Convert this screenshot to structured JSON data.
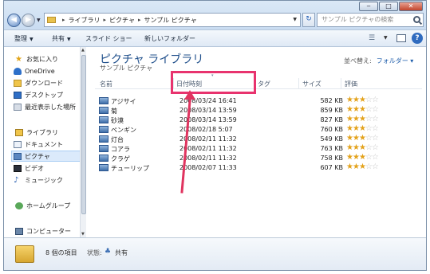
{
  "window": {
    "minimize": "‒",
    "maximize": "□",
    "close": "✕"
  },
  "address": {
    "crumbs": [
      "ライブラリ",
      "ピクチャ",
      "サンプル ピクチャ"
    ],
    "separator": "▸",
    "search_placeholder": "サンプル ピクチャの検索"
  },
  "toolbar": {
    "organize": "整理",
    "share": "共有",
    "slideshow": "スライド ショー",
    "new_folder": "新しいフォルダー"
  },
  "nav": {
    "favorites": "お気に入り",
    "onedrive": "OneDrive",
    "downloads": "ダウンロード",
    "desktop": "デスクトップ",
    "recent": "最近表示した場所",
    "libraries": "ライブラリ",
    "documents": "ドキュメント",
    "pictures": "ピクチャ",
    "videos": "ビデオ",
    "music": "ミュージック",
    "homegroup": "ホームグループ",
    "computer": "コンピューター"
  },
  "library": {
    "title": "ピクチャ ライブラリ",
    "subtitle": "サンプル ピクチャ",
    "arrange_label": "並べ替え:",
    "arrange_value": "フォルダー ▾"
  },
  "columns": {
    "name": "名前",
    "date": "日付時刻",
    "tags": "タグ",
    "size": "サイズ",
    "rating": "評価"
  },
  "files": [
    {
      "name": "アジサイ",
      "date": "2008/03/24 16:41",
      "size": "582 KB",
      "rating": 3
    },
    {
      "name": "菊",
      "date": "2008/03/14 13:59",
      "size": "859 KB",
      "rating": 3
    },
    {
      "name": "砂漠",
      "date": "2008/03/14 13:59",
      "size": "827 KB",
      "rating": 3
    },
    {
      "name": "ペンギン",
      "date": "2008/02/18 5:07",
      "size": "760 KB",
      "rating": 3
    },
    {
      "name": "灯台",
      "date": "2008/02/11 11:32",
      "size": "549 KB",
      "rating": 3
    },
    {
      "name": "コアラ",
      "date": "2008/02/11 11:32",
      "size": "763 KB",
      "rating": 3
    },
    {
      "name": "クラゲ",
      "date": "2008/02/11 11:32",
      "size": "758 KB",
      "rating": 3
    },
    {
      "name": "チューリップ",
      "date": "2008/02/07 11:33",
      "size": "607 KB",
      "rating": 3
    }
  ],
  "details": {
    "count": "8 個の項目",
    "state_label": "状態:",
    "state_value": "共有"
  },
  "colors": {
    "highlight": "#e8336e",
    "title_blue": "#1f4f8b",
    "star": "#e3a21b"
  }
}
